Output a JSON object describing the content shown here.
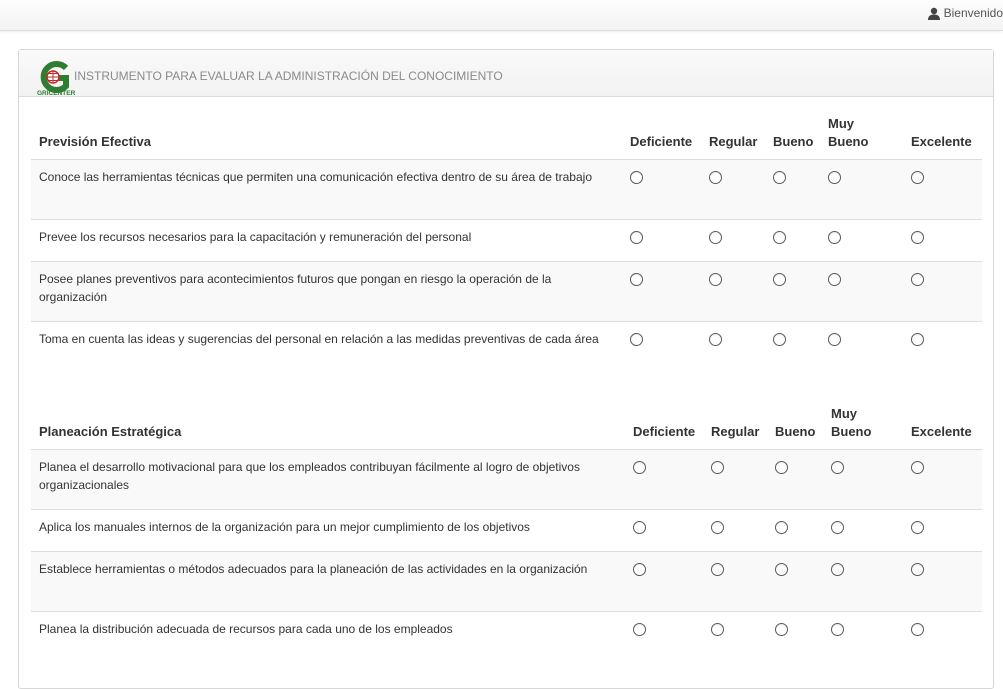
{
  "header": {
    "user_label": "Bienvenido",
    "user_icon": "user-icon"
  },
  "panel": {
    "title": "INSTRUMENTO PARA EVALUAR LA ADMINISTRACIÓN DEL CONOCIMIENTO",
    "logo_text": "GRICENTER",
    "logo_colors": {
      "green": "#2e7d32",
      "red": "#c62828"
    }
  },
  "sections": [
    {
      "title": "Previsión Efectiva",
      "columns": [
        "Deficiente",
        "Regular",
        "Bueno",
        "Muy Bueno",
        "Excelente"
      ],
      "questions": [
        "Conoce las herramientas técnicas que permiten una comunicación efectiva dentro de su área de trabajo",
        "Prevee los recursos necesarios para la capacitación y remuneración del personal",
        "Posee planes preventivos para acontecimientos futuros que pongan en riesgo la operación de la organización",
        "Toma en cuenta las ideas y sugerencias del personal en relación a las medidas preventivas de cada área"
      ]
    },
    {
      "title": "Planeación Estratégica",
      "columns": [
        "Deficiente",
        "Regular",
        "Bueno",
        "Muy Bueno",
        "Excelente"
      ],
      "questions": [
        "Planea el desarrollo motivacional para que los empleados contribuyan fácilmente al logro de objetivos organizacionales",
        "Aplica los manuales internos de la organización para un mejor cumplimiento de los objetivos",
        "Establece herramientas o métodos adecuados para la planeación de las actividades en la organización",
        "Planea la distribución adecuada de recursos para cada uno de los empleados"
      ]
    }
  ]
}
